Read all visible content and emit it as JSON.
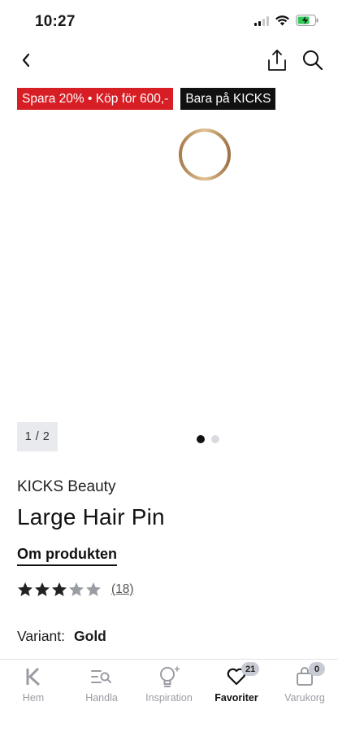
{
  "status_bar": {
    "time": "10:27"
  },
  "badges": {
    "sale": "Spara 20% • Köp för 600,-",
    "exclusive": "Bara på KICKS"
  },
  "gallery": {
    "counter": "1 / 2",
    "total_images": 2,
    "current_index": 1
  },
  "product": {
    "brand": "KICKS Beauty",
    "title": "Large Hair Pin",
    "about_link": "Om produkten",
    "rating": 3,
    "rating_max": 5,
    "review_count": "(18)",
    "variant_label": "Variant:",
    "variant_value": "Gold",
    "image_color": "#c39a6b"
  },
  "tab_bar": {
    "tabs": [
      {
        "label": "Hem",
        "icon": "k-logo-icon"
      },
      {
        "label": "Handla",
        "icon": "list-search-icon"
      },
      {
        "label": "Inspiration",
        "icon": "lightbulb-icon"
      },
      {
        "label": "Favoriter",
        "icon": "heart-icon",
        "badge": "21",
        "active": true
      },
      {
        "label": "Varukorg",
        "icon": "bag-icon",
        "badge": "0"
      }
    ]
  },
  "colors": {
    "sale_red": "#d61e24",
    "exclusive_black": "#111111",
    "star_filled": "#222222",
    "star_empty": "#9a9ca3"
  }
}
